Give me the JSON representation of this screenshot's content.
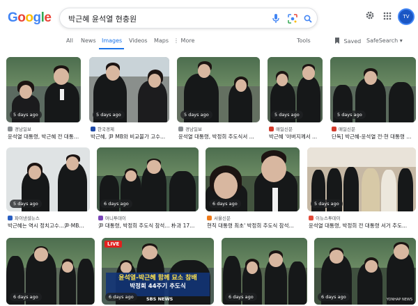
{
  "search": {
    "query": "박근혜 윤석열 현충원"
  },
  "header": {
    "logo_letters": [
      "G",
      "o",
      "o",
      "g",
      "l",
      "e"
    ],
    "avatar_text": "TV"
  },
  "tabs": {
    "items": [
      "All",
      "News",
      "Images",
      "Videos",
      "Maps",
      "More"
    ],
    "active": "Images",
    "tools": "Tools",
    "saved": "Saved",
    "safesearch": "SafeSearch"
  },
  "results": [
    {
      "age": "5 days ago",
      "source": "경남일보",
      "caption": "윤석열 대통령, 박근혜 전 대통령 추도...",
      "fav_color": "#8a8f93"
    },
    {
      "age": "5 days ago",
      "source": "한국경제",
      "caption": "박근혜, 尹 MB와 비교불가 고수...",
      "fav_color": "#1f4aa8"
    },
    {
      "age": "5 days ago",
      "source": "경남일보",
      "caption": "윤석열 대통령, 박정희 추도식서 ...",
      "fav_color": "#8a8f93"
    },
    {
      "age": "5 days ago",
      "source": "매일신문",
      "caption": "박근혜 '아버지께서 ...",
      "fav_color": "#d33b2c"
    },
    {
      "age": "5 days ago",
      "source": "매일신문",
      "caption": "단독] 박근혜-윤석열 전·현 대통령 ...",
      "fav_color": "#d33b2c"
    },
    {
      "age": "5 days ago",
      "source": "파이낸셜뉴스",
      "caption": "박근혜는 역시 정치고수...尹·MB...",
      "fav_color": "#2a5fc2"
    },
    {
      "age": "6 days ago",
      "source": "머니투데이",
      "caption": "尹 대통령, 박정희 추도식 참석... 朴과 17...",
      "fav_color": "#7a46b8"
    },
    {
      "age": "6 days ago",
      "source": "서울신문",
      "caption": "현직 대통령 최초' 박정희 추도식 참석...",
      "fav_color": "#ef7a1a"
    },
    {
      "age": "5 days ago",
      "source": "이뉴스투데이",
      "caption": "윤석열 대통령, 박정희 전 대통령 서거 추도...",
      "fav_color": "#e34b3a"
    },
    {
      "age": "6 days ago",
      "source": "",
      "caption": "",
      "fav_color": "#888"
    },
    {
      "age": "6 days ago",
      "source": "",
      "caption": "",
      "fav_color": "#888",
      "live": "LIVE",
      "banner_line1": "윤석열-박근혜 함께 묘소 참배",
      "banner_line2": "박정희 44주기 추도식",
      "channel": "SBS NEWS"
    },
    {
      "age": "6 days ago",
      "source": "",
      "caption": "",
      "fav_color": "#888"
    },
    {
      "age": "6 days ago",
      "source": "",
      "caption": "",
      "fav_color": "#888",
      "watermark": "YONHAP NEWS"
    }
  ]
}
